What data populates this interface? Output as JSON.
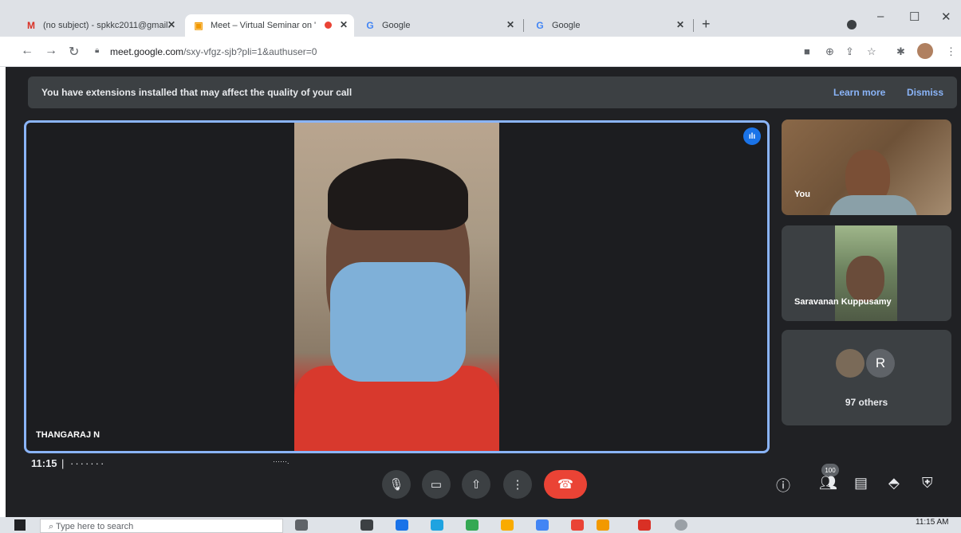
{
  "browser": {
    "tabs": [
      {
        "label": "(no subject) - spkkc2011@gmail.c",
        "favicon": "gmail-icon",
        "active": false
      },
      {
        "label": "Meet – Virtual Seminar on 'U",
        "favicon": "meet-icon",
        "active": true,
        "recording": true
      },
      {
        "label": "Google",
        "favicon": "google-icon",
        "active": false
      },
      {
        "label": "Google",
        "favicon": "google-icon",
        "active": false
      }
    ],
    "new_tab": "+",
    "url_domain": "meet.google.com",
    "url_rest": "/sxy-vfgz-sjb?pli=1&authuser=0"
  },
  "banner": {
    "text": "You have extensions installed that may affect the quality of your call",
    "learn_more": "Learn more",
    "dismiss": "Dismiss"
  },
  "main_tile": {
    "name": "THANGARAJ N",
    "speaking_indicator": "ılı"
  },
  "side_tiles": {
    "you": "You",
    "saravanan": "Saravanan Kuppusamy",
    "others_initial": "R",
    "others_count": "97 others"
  },
  "controls": {
    "time": "11:15",
    "meeting_code_masked": "| ·······",
    "meeting_code_masked2": "······.",
    "participants_count": "100"
  },
  "taskbar": {
    "search_placeholder": "Type here to search",
    "time": "11:15 AM"
  },
  "colors": {
    "meet_background": "#202124",
    "accent_blue": "#8ab4f8",
    "hangup_red": "#ea4335"
  }
}
